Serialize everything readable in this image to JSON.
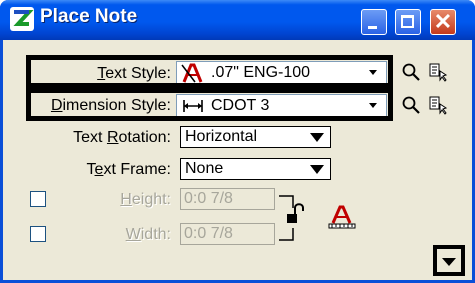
{
  "window": {
    "title": "Place Note"
  },
  "titlebar_buttons": [
    "minimize",
    "maximize",
    "close"
  ],
  "rows": {
    "text_style": {
      "label": "Text Style:",
      "underline": "T",
      "rest": "ext Style:",
      "value": ".07\"  ENG-100",
      "icon": "text-style-icon"
    },
    "dimension_style": {
      "label": "Dimension Style:",
      "underline": "D",
      "rest": "imension Style:",
      "value": "CDOT 3",
      "icon": "dimension-icon"
    },
    "text_rotation": {
      "label": "Text Rotation:",
      "value": "Horizontal"
    },
    "text_frame": {
      "label": "Text Frame:",
      "value": "None"
    },
    "height": {
      "label": "Height:",
      "value": "0:0 7/8"
    },
    "width": {
      "label": "Width:",
      "value": "0:0 7/8"
    }
  },
  "labels": {
    "text_rotation_pre": "Text ",
    "text_rotation_u": "R",
    "text_rotation_post": "otation:",
    "text_frame_pre": "T",
    "text_frame_u": "e",
    "text_frame_post": "xt Frame:",
    "height_u": "H",
    "height_post": "eight:",
    "width_u": "W",
    "width_post": "idth:"
  }
}
